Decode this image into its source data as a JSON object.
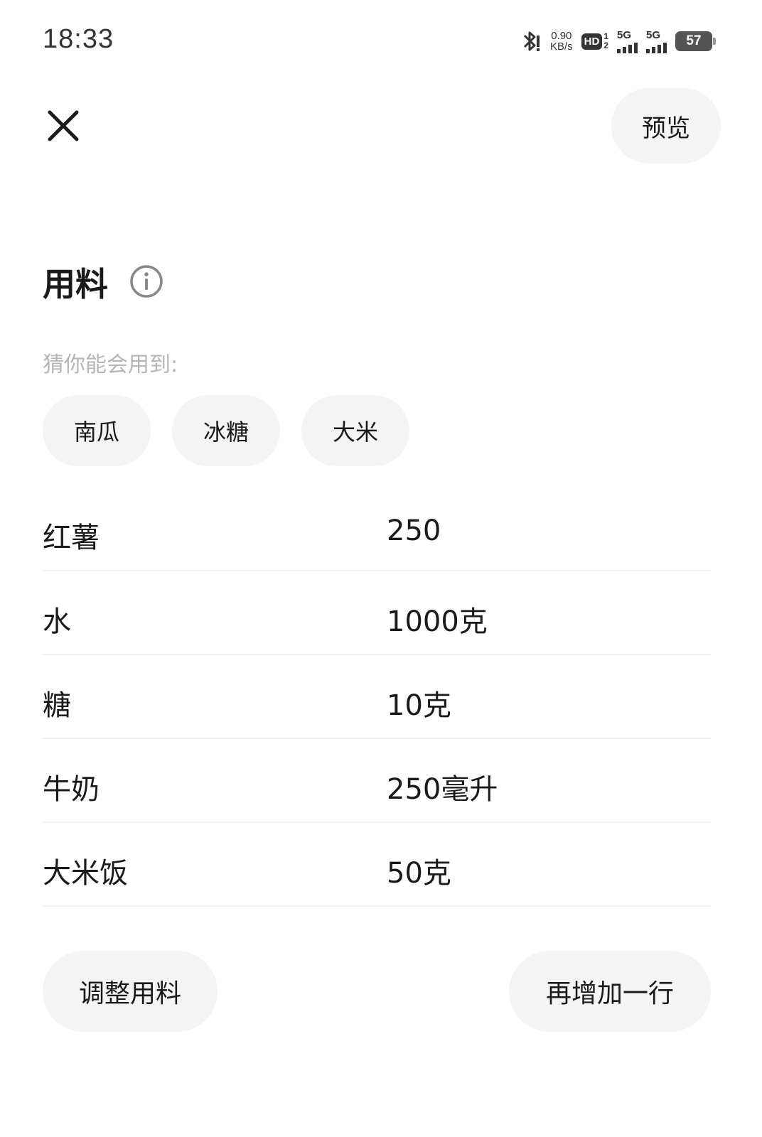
{
  "status_bar": {
    "time": "18:33",
    "net_speed_value": "0.90",
    "net_speed_unit": "KB/s",
    "hd_label": "HD",
    "hd_sub_top": "1",
    "hd_sub_bottom": "2",
    "signal1_label": "5G",
    "signal2_label": "5G",
    "battery_level": "57",
    "icons": [
      "bluetooth-icon",
      "hd-voice-icon",
      "signal-icon",
      "signal-icon",
      "battery-icon"
    ]
  },
  "header": {
    "close_icon": "close-icon",
    "preview_label": "预览"
  },
  "section": {
    "title": "用料",
    "info_icon": "info-icon",
    "hint": "猜你能会用到:"
  },
  "suggestions": [
    {
      "label": "南瓜"
    },
    {
      "label": "冰糖"
    },
    {
      "label": "大米"
    }
  ],
  "ingredients": [
    {
      "name": "红薯",
      "amount": "250"
    },
    {
      "name": "水",
      "amount": "1000克"
    },
    {
      "name": "糖",
      "amount": "10克"
    },
    {
      "name": "牛奶",
      "amount": "250毫升"
    },
    {
      "name": "大米饭",
      "amount": "50克"
    }
  ],
  "actions": {
    "adjust_label": "调整用料",
    "add_row_label": "再增加一行"
  },
  "colors": {
    "background": "#ffffff",
    "chip_bg": "#f4f4f4",
    "text": "#1a1a1a",
    "hint": "#b5b5b5",
    "divider": "#f0f0f0"
  }
}
